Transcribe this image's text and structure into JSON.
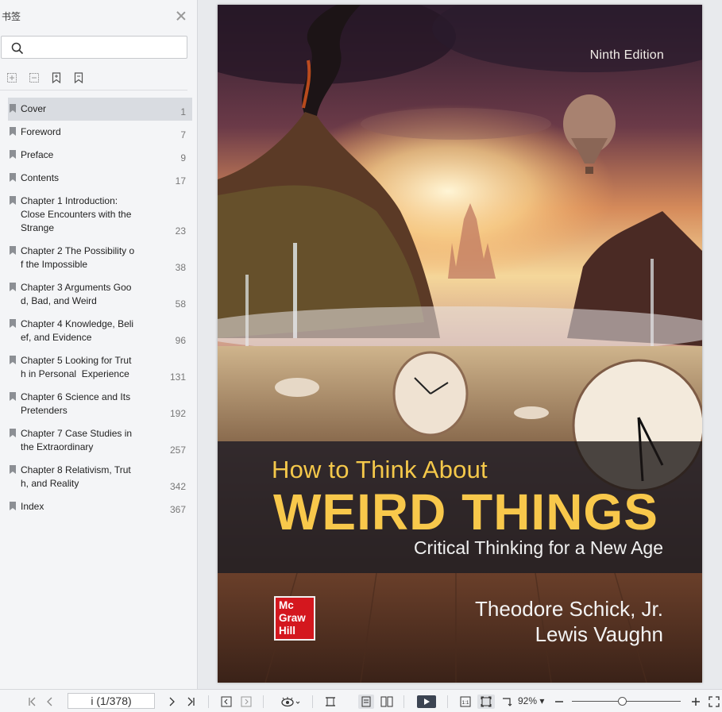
{
  "sidebar": {
    "title": "书签",
    "search": {
      "value": "",
      "placeholder": ""
    },
    "bookmarks": [
      {
        "label": "Cover",
        "page": "1"
      },
      {
        "label": "Foreword",
        "page": "7"
      },
      {
        "label": "Preface",
        "page": "9"
      },
      {
        "label": "Contents",
        "page": "17"
      },
      {
        "label": "Chapter 1 Introduction:\nClose Encounters with the  Strange",
        "page": "23"
      },
      {
        "label": "Chapter 2 The Possibility of the Impossible",
        "page": "38"
      },
      {
        "label": "Chapter 3 Arguments Good, Bad, and Weird",
        "page": "58"
      },
      {
        "label": "Chapter 4 Knowledge, Belief, and Evidence",
        "page": "96"
      },
      {
        "label": "Chapter 5 Looking for Truth in Personal  Experience",
        "page": "131"
      },
      {
        "label": "Chapter 6 Science and Its Pretenders",
        "page": "192"
      },
      {
        "label": "Chapter 7 Case Studies in the Extraordinary",
        "page": "257"
      },
      {
        "label": "Chapter 8 Relativism, Truth, and Reality",
        "page": "342"
      },
      {
        "label": "Index",
        "page": "367"
      }
    ]
  },
  "cover": {
    "edition": "Ninth Edition",
    "pre_title": "How to Think About",
    "title": "WEIRD THINGS",
    "subtitle": "Critical Thinking for a New Age",
    "author1": "Theodore Schick, Jr.",
    "author2": "Lewis Vaughn",
    "publisher_logo": [
      "Mc",
      "Graw",
      "Hill"
    ]
  },
  "toolbar": {
    "page_indicator": "i (1/378)",
    "zoom": "92%",
    "zoom_fraction": 0.92
  },
  "colors": {
    "title_yellow": "#f8c84b",
    "logo_red": "#d4171e",
    "sidebar_bg": "#f4f5f7",
    "active_bookmark": "#d9dce1"
  }
}
